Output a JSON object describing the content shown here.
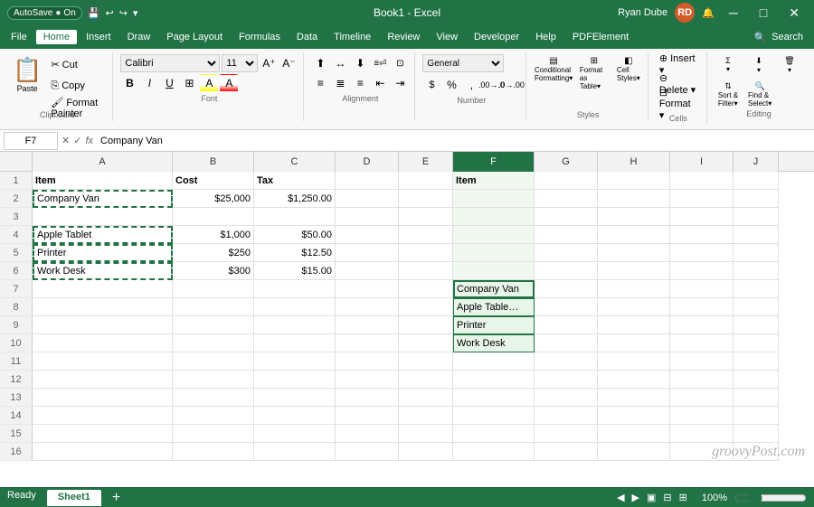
{
  "titlebar": {
    "autosave_label": "AutoSave",
    "autosave_state": "On",
    "title": "Book1 - Excel",
    "user_name": "Ryan Dube",
    "user_initials": "RD"
  },
  "menu": {
    "items": [
      "File",
      "Home",
      "Insert",
      "Draw",
      "Page Layout",
      "Formulas",
      "Data",
      "Timeline",
      "Review",
      "View",
      "Developer",
      "Help",
      "PDFElement"
    ]
  },
  "ribbon": {
    "clipboard": {
      "label": "Clipboard"
    },
    "font": {
      "label": "Font",
      "font_name": "Calibri",
      "font_size": "11"
    },
    "alignment": {
      "label": "Alignment"
    },
    "number": {
      "label": "Number",
      "format": "General"
    },
    "styles": {
      "label": "Styles"
    },
    "cells": {
      "label": "Cells"
    },
    "editing": {
      "label": "Editing"
    }
  },
  "formula_bar": {
    "cell_ref": "F7",
    "formula": "Company Van"
  },
  "columns": {
    "headers": [
      "A",
      "B",
      "C",
      "D",
      "E",
      "F",
      "G",
      "H",
      "I",
      "J"
    ]
  },
  "spreadsheet": {
    "rows": [
      {
        "num": 1,
        "cells": [
          {
            "val": "Item",
            "bold": true
          },
          {
            "val": "Cost",
            "bold": true
          },
          {
            "val": "Tax",
            "bold": true
          },
          "",
          "",
          "Item",
          "",
          "",
          "",
          ""
        ]
      },
      {
        "num": 2,
        "cells": [
          {
            "val": "Company Van",
            "dashed": true
          },
          "$25,000",
          "$1,250.00",
          "",
          "",
          "",
          "",
          "",
          "",
          ""
        ]
      },
      {
        "num": 3,
        "cells": [
          "",
          "",
          "",
          "",
          "",
          "",
          "",
          "",
          "",
          ""
        ]
      },
      {
        "num": 4,
        "cells": [
          {
            "val": "Apple Tablet",
            "dashed": true
          },
          "$1,000",
          "$50.00",
          "",
          "",
          "",
          "",
          "",
          "",
          ""
        ]
      },
      {
        "num": 5,
        "cells": [
          {
            "val": "Printer",
            "dashed": true
          },
          "$250",
          "$12.50",
          "",
          "",
          "",
          "",
          "",
          "",
          ""
        ]
      },
      {
        "num": 6,
        "cells": [
          {
            "val": "Work Desk",
            "dashed": true
          },
          "$300",
          "$15.00",
          "",
          "",
          "",
          "",
          "",
          "",
          ""
        ]
      },
      {
        "num": 7,
        "cells": [
          "",
          "",
          "",
          "",
          "",
          {
            "val": "Company Van",
            "paste": true
          },
          "",
          "",
          "",
          ""
        ]
      },
      {
        "num": 8,
        "cells": [
          "",
          "",
          "",
          "",
          "",
          {
            "val": "Apple Tablet",
            "paste": true
          },
          "",
          "",
          "",
          ""
        ]
      },
      {
        "num": 9,
        "cells": [
          "",
          "",
          "",
          "",
          "",
          {
            "val": "Printer",
            "paste": true
          },
          "",
          "",
          "",
          ""
        ]
      },
      {
        "num": 10,
        "cells": [
          "",
          "",
          "",
          "",
          "",
          {
            "val": "Work Desk",
            "paste": true
          },
          "",
          "",
          "",
          ""
        ]
      },
      {
        "num": 11,
        "cells": [
          "",
          "",
          "",
          "",
          "",
          "",
          "",
          "",
          "",
          ""
        ]
      },
      {
        "num": 12,
        "cells": [
          "",
          "",
          "",
          "",
          "",
          "",
          "",
          "",
          "",
          ""
        ]
      },
      {
        "num": 13,
        "cells": [
          "",
          "",
          "",
          "",
          "",
          "",
          "",
          "",
          "",
          ""
        ]
      },
      {
        "num": 14,
        "cells": [
          "",
          "",
          "",
          "",
          "",
          "",
          "",
          "",
          "",
          ""
        ]
      },
      {
        "num": 15,
        "cells": [
          "",
          "",
          "",
          "",
          "",
          "",
          "",
          "",
          "",
          ""
        ]
      },
      {
        "num": 16,
        "cells": [
          "",
          "",
          "",
          "",
          "",
          "",
          "",
          "",
          "",
          ""
        ]
      }
    ]
  },
  "status_bar": {
    "sheet_name": "Sheet1",
    "add_sheet_label": "+",
    "ready_label": "Ready",
    "zoom_level": "100%"
  },
  "watermark": "groovyPost.com"
}
